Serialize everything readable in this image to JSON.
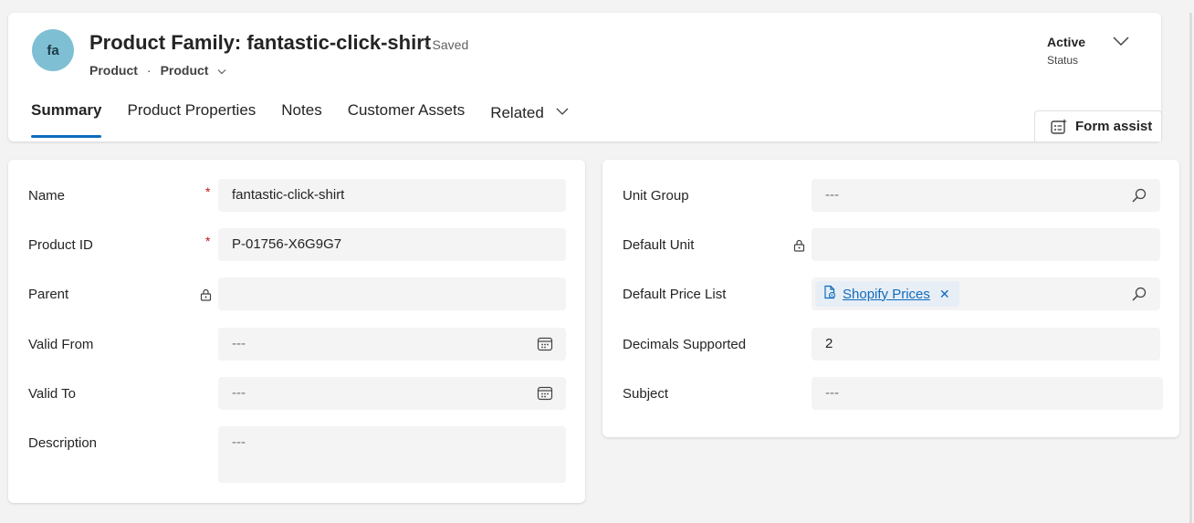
{
  "header": {
    "avatar_initials": "fa",
    "title": "Product Family: fantastic-click-shirt",
    "save_status": "- Saved",
    "breadcrumb_entity": "Product",
    "breadcrumb_form": "Product",
    "status_value": "Active",
    "status_label": "Status",
    "form_assist_label": "Form assist"
  },
  "tabs": [
    {
      "label": "Summary",
      "active": true
    },
    {
      "label": "Product Properties"
    },
    {
      "label": "Notes"
    },
    {
      "label": "Customer Assets"
    },
    {
      "label": "Related",
      "has_dropdown": true
    }
  ],
  "left_fields": [
    {
      "label": "Name",
      "required": true,
      "value": "fantastic-click-shirt"
    },
    {
      "label": "Product ID",
      "required": true,
      "value": "P-01756-X6G9G7"
    },
    {
      "label": "Parent",
      "locked": true,
      "value": ""
    },
    {
      "label": "Valid From",
      "value": "---",
      "icon": "calendar-icon"
    },
    {
      "label": "Valid To",
      "value": "---",
      "icon": "calendar-icon"
    },
    {
      "label": "Description",
      "value": "---"
    }
  ],
  "right_fields": [
    {
      "label": "Unit Group",
      "value": "---",
      "icon": "search-icon"
    },
    {
      "label": "Default Unit",
      "locked": true,
      "value": ""
    },
    {
      "label": "Default Price List",
      "lookup_value": "Shopify Prices",
      "icon": "search-icon"
    },
    {
      "label": "Decimals Supported",
      "value": "2"
    },
    {
      "label": "Subject",
      "value": "---"
    }
  ],
  "colors": {
    "accent": "#0f6cbd",
    "required": "#c50f1f",
    "avatar": "#7fbfd4"
  }
}
